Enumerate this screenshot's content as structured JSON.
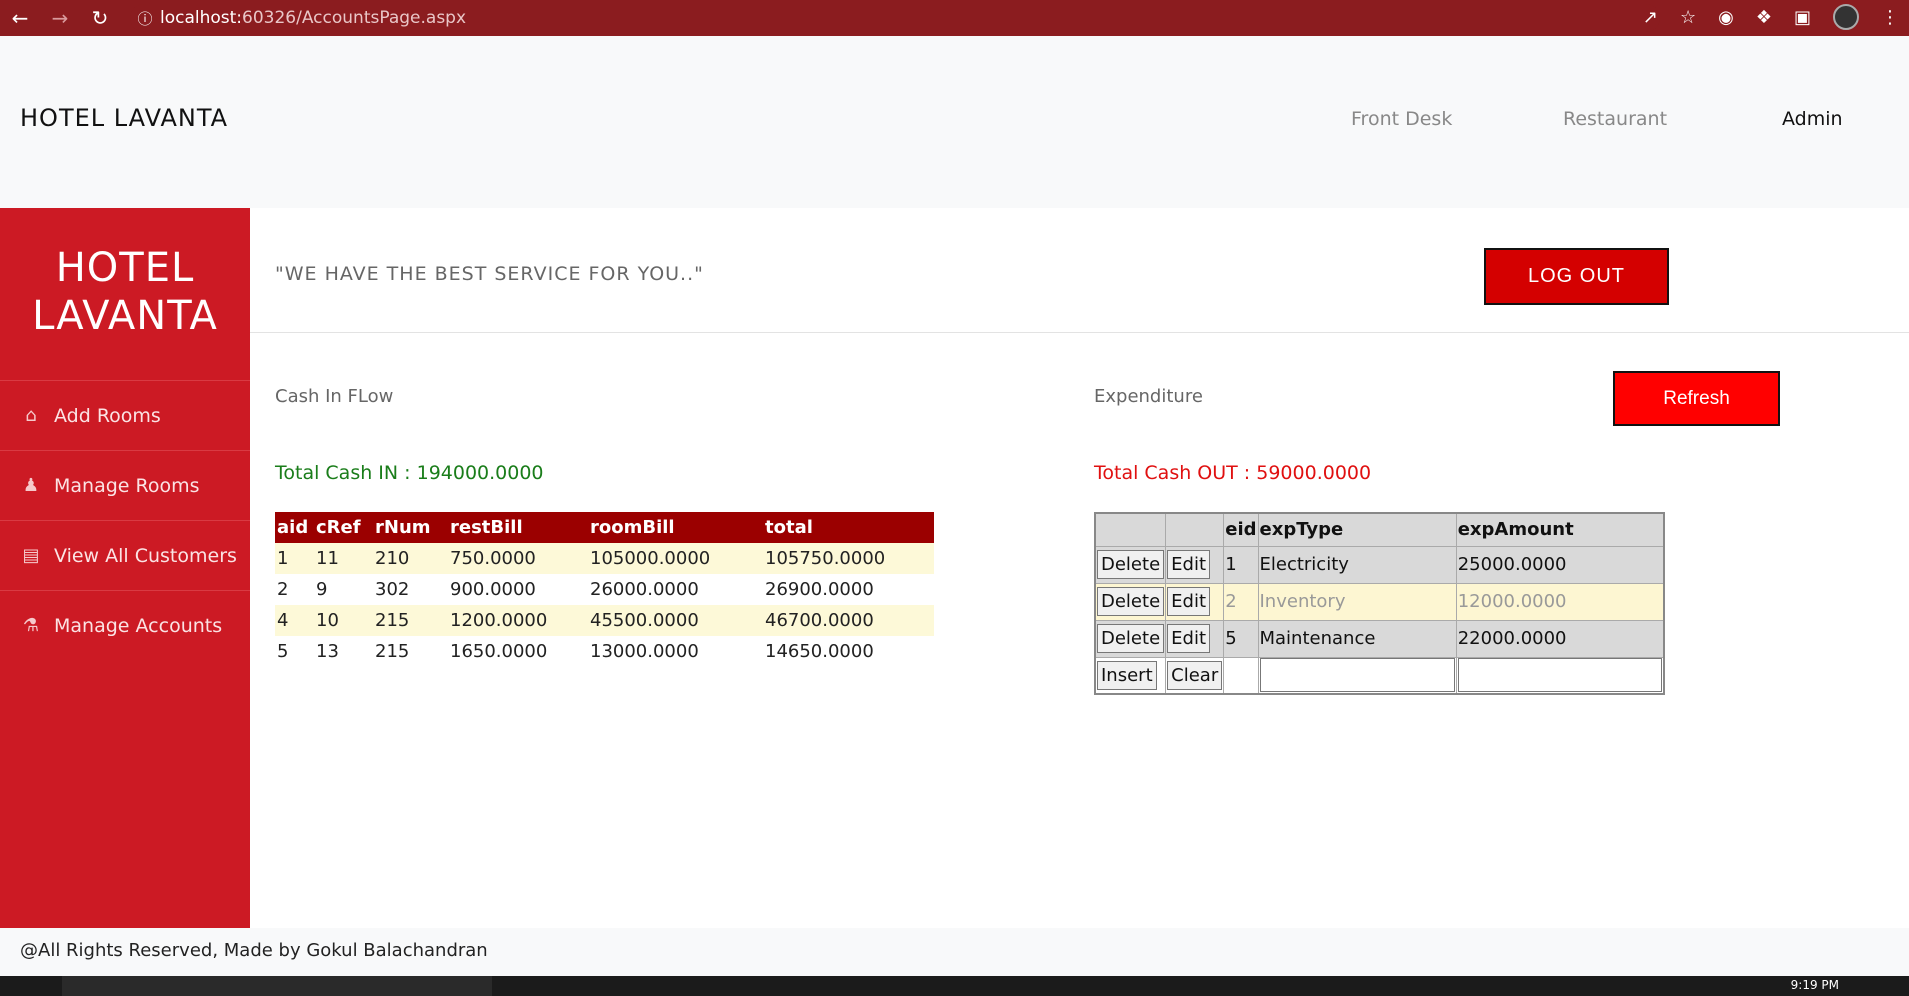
{
  "browser": {
    "url_host": "localhost:",
    "url_port_path": "60326/AccountsPage.aspx"
  },
  "navbar": {
    "brand": "HOTEL LAVANTA",
    "links": [
      "Front Desk",
      "Restaurant",
      "Admin"
    ]
  },
  "sidebar": {
    "title_line1": "HOTEL",
    "title_line2": "LAVANTA",
    "items": [
      {
        "label": "Add Rooms",
        "icon": "home-icon"
      },
      {
        "label": "Manage Rooms",
        "icon": "user-icon"
      },
      {
        "label": "View All Customers",
        "icon": "id-card-icon"
      },
      {
        "label": "Manage Accounts",
        "icon": "sitemap-icon"
      }
    ]
  },
  "header": {
    "motto": "\"WE HAVE THE BEST SERVICE FOR YOU..\"",
    "logout_label": "LOG OUT"
  },
  "cash_in": {
    "section_label": "Cash In FLow",
    "total_label": "Total Cash IN : 194000.0000",
    "columns": [
      "aid",
      "cRef",
      "rNum",
      "restBill",
      "roomBill",
      "total"
    ],
    "rows": [
      [
        "1",
        "11",
        "210",
        "750.0000",
        "105000.0000",
        "105750.0000"
      ],
      [
        "2",
        "9",
        "302",
        "900.0000",
        "26000.0000",
        "26900.0000"
      ],
      [
        "4",
        "10",
        "215",
        "1200.0000",
        "45500.0000",
        "46700.0000"
      ],
      [
        "5",
        "13",
        "215",
        "1650.0000",
        "13000.0000",
        "14650.0000"
      ]
    ]
  },
  "expenditure": {
    "section_label": "Expenditure",
    "refresh_label": "Refresh",
    "total_label": "Total Cash OUT : 59000.0000",
    "columns": [
      "eid",
      "expType",
      "expAmount"
    ],
    "delete_label": "Delete",
    "edit_label": "Edit",
    "insert_label": "Insert",
    "clear_label": "Clear",
    "rows": [
      [
        "1",
        "Electricity",
        "25000.0000"
      ],
      [
        "2",
        "Inventory",
        "12000.0000"
      ],
      [
        "5",
        "Maintenance",
        "22000.0000"
      ]
    ]
  },
  "footer": {
    "text": "@All Rights Reserved, Made by Gokul Balachandran"
  },
  "taskbar": {
    "time": "9:19 PM"
  }
}
